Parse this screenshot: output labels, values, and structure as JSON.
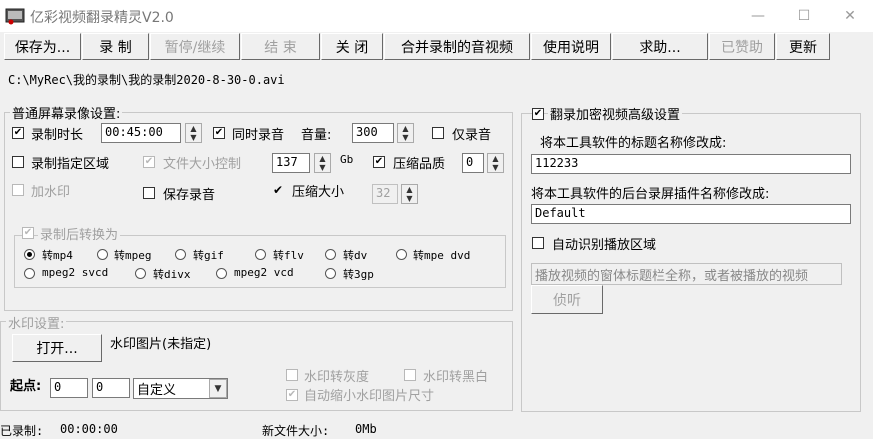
{
  "window": {
    "title": "亿彩视频翻录精灵V2.0",
    "controls": [
      "—",
      "☐",
      "✕"
    ]
  },
  "toolbar": [
    {
      "label": "保存为...",
      "enabled": true
    },
    {
      "label": "录  制",
      "enabled": true
    },
    {
      "label": "暂停/继续",
      "enabled": false
    },
    {
      "label": "结  束",
      "enabled": false
    },
    {
      "label": "关  闭",
      "enabled": true
    },
    {
      "label": "合并录制的音视频",
      "enabled": true
    },
    {
      "label": "使用说明",
      "enabled": true
    },
    {
      "label": "求助...",
      "enabled": true
    },
    {
      "label": "已赞助",
      "enabled": false
    },
    {
      "label": "更新",
      "enabled": true
    }
  ],
  "save_path": "C:\\MyRec\\我的录制\\我的录制2020-8-30-0.avi",
  "screen_settings": {
    "legend": "普通屏幕录像设置:",
    "record_duration_label": "录制时长",
    "record_duration_value": "00:45:00",
    "sync_audio_label": "同时录音",
    "volume_label": "音量:",
    "volume_value": "300",
    "audio_only_label": "仅录音",
    "region_label": "录制指定区域",
    "filesize_label": "文件大小控制",
    "filesize_value": "137",
    "filesize_unit": "Gb",
    "compress_quality_label": "压缩品质",
    "compress_quality_value": "0",
    "watermark_label": "加水印",
    "save_audio_label": "保存录音",
    "compress_size_label": "压缩大小",
    "compress_size_value": "32"
  },
  "convert": {
    "legend": "录制后转换为",
    "options": [
      "转mp4",
      "转mpeg",
      "转gif",
      "转flv",
      "转dv",
      "转mpe dvd",
      "mpeg2 svcd",
      "转divx",
      "mpeg2 vcd",
      "转3gp"
    ],
    "selected": "转mp4"
  },
  "watermark": {
    "legend": "水印设置:",
    "open_button": "打开...",
    "image_label": "水印图片(未指定)",
    "origin_label": "起点:",
    "x_value": "0",
    "y_value": "0",
    "position_select": "自定义",
    "grayscale_label": "水印转灰度",
    "blackwhite_label": "水印转黑白",
    "autoshrink_label": "自动缩小水印图片尺寸"
  },
  "advanced": {
    "legend": "翻录加密视频高级设置",
    "title_rename_label": "将本工具软件的标题名称修改成:",
    "title_rename_value": "112233",
    "plugin_rename_label": "将本工具软件的后台录屏插件名称修改成:",
    "plugin_rename_value": "Default",
    "auto_detect_label": "自动识别播放区域",
    "window_title_placeholder": "播放视频的窗体标题栏全称，或者被播放的视频",
    "listen_button": "侦听"
  },
  "status": {
    "recorded_label": "已录制:",
    "recorded_value": "00:00:00",
    "new_file_size_label": "新文件大小:",
    "new_file_size_value": "0Mb"
  }
}
